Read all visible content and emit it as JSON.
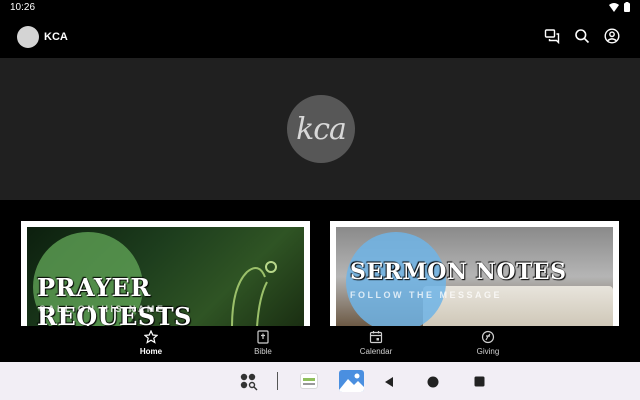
{
  "status": {
    "time": "10:26"
  },
  "header": {
    "title": "KCA"
  },
  "hero": {
    "logo_text": "kca"
  },
  "cards": [
    {
      "title": "PRAYER REQUESTS",
      "subtitle": "CALL ON HIS NAME"
    },
    {
      "title": "SERMON NOTES",
      "subtitle": "FOLLOW THE MESSAGE"
    }
  ],
  "nav": [
    {
      "label": "Home",
      "icon": "star-icon",
      "active": true
    },
    {
      "label": "Bible",
      "icon": "bible-icon",
      "active": false
    },
    {
      "label": "Calendar",
      "icon": "calendar-icon",
      "active": false
    },
    {
      "label": "Giving",
      "icon": "giving-icon",
      "active": false
    }
  ],
  "colors": {
    "background": "#000000",
    "hero": "#202020",
    "system_nav": "#f2eef5"
  }
}
